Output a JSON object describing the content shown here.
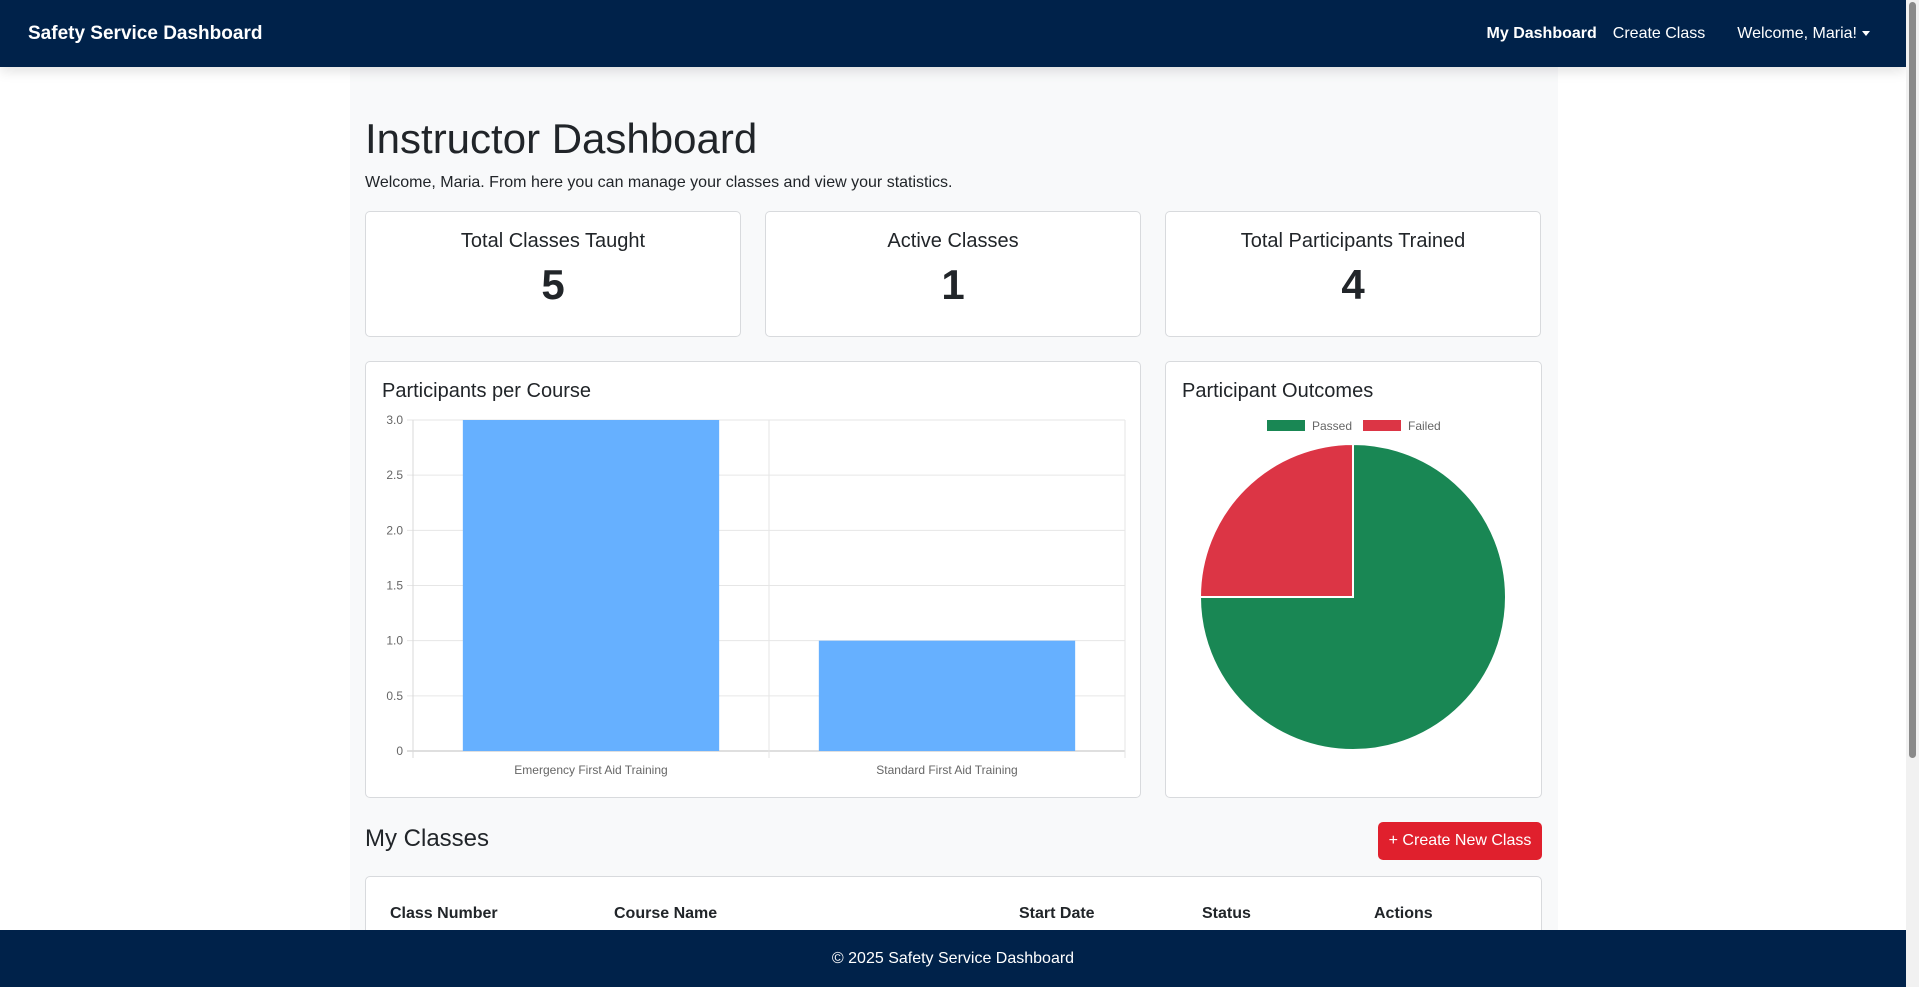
{
  "navbar": {
    "brand": "Safety Service Dashboard",
    "links": [
      {
        "label": "My Dashboard",
        "active": true
      },
      {
        "label": "Create Class",
        "active": false
      }
    ],
    "user_menu": "Welcome, Maria!"
  },
  "page": {
    "title": "Instructor Dashboard",
    "subtitle": "Welcome, Maria. From here you can manage your classes and view your statistics."
  },
  "stats": [
    {
      "label": "Total Classes Taught",
      "value": "5"
    },
    {
      "label": "Active Classes",
      "value": "1"
    },
    {
      "label": "Total Participants Trained",
      "value": "4"
    }
  ],
  "charts": {
    "bar_title": "Participants per Course",
    "pie_title": "Participant Outcomes"
  },
  "chart_data": [
    {
      "type": "bar",
      "title": "Participants per Course",
      "categories": [
        "Emergency First Aid Training",
        "Standard First Aid Training"
      ],
      "values": [
        3,
        1
      ],
      "ylim": [
        0,
        3
      ],
      "yticks": [
        "0",
        "0.5",
        "1.0",
        "1.5",
        "2.0",
        "2.5",
        "3.0"
      ],
      "color": "#66b0ff",
      "grid": true
    },
    {
      "type": "pie",
      "title": "Participant Outcomes",
      "labels": [
        "Passed",
        "Failed"
      ],
      "values": [
        3,
        1
      ],
      "colors": [
        "#198754",
        "#dc3545"
      ],
      "legend": "top"
    }
  ],
  "classes": {
    "title": "My Classes",
    "create_button": "+ Create New Class",
    "columns": [
      "Class Number",
      "Course Name",
      "Start Date",
      "Status",
      "Actions"
    ]
  },
  "footer": {
    "text": "© 2025 Safety Service Dashboard"
  },
  "colors": {
    "navbar": "#00224a",
    "accent": "#e0202d",
    "bar": "#66b0ff",
    "passed": "#198754",
    "failed": "#dc3545"
  }
}
